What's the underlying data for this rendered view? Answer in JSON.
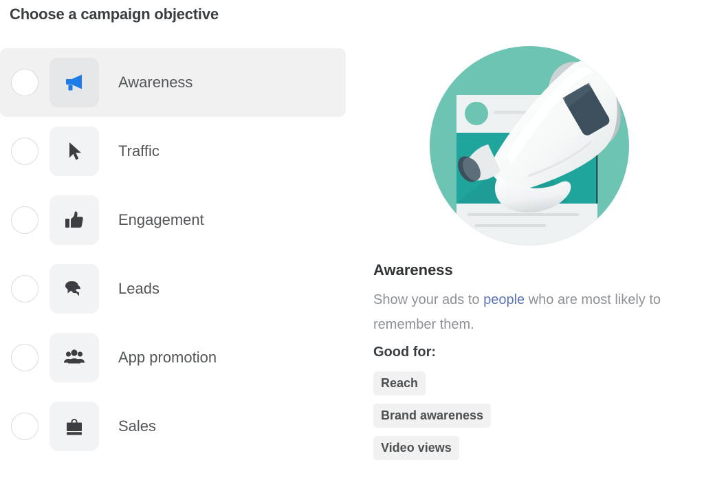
{
  "page": {
    "title": "Choose a campaign objective"
  },
  "objectives": [
    {
      "id": "awareness",
      "label": "Awareness",
      "icon": "megaphone-icon",
      "selected": true,
      "icon_color": "#1d7ce8"
    },
    {
      "id": "traffic",
      "label": "Traffic",
      "icon": "cursor-arrow-icon",
      "selected": false,
      "icon_color": "#3b3f42"
    },
    {
      "id": "engagement",
      "label": "Engagement",
      "icon": "thumbs-up-icon",
      "selected": false,
      "icon_color": "#3b3f42"
    },
    {
      "id": "leads",
      "label": "Leads",
      "icon": "chat-bubbles-icon",
      "selected": false,
      "icon_color": "#3b3f42"
    },
    {
      "id": "app-promotion",
      "label": "App promotion",
      "icon": "people-group-icon",
      "selected": false,
      "icon_color": "#3b3f42"
    },
    {
      "id": "sales",
      "label": "Sales",
      "icon": "shopping-bag-icon",
      "selected": false,
      "icon_color": "#3b3f42"
    }
  ],
  "detail": {
    "illustration": "megaphone-illustration",
    "title": "Awareness",
    "description_before": "Show your ads to ",
    "description_link": "people",
    "description_after": " who are most likely to remember them.",
    "good_for_label": "Good for:",
    "chips": [
      "Reach",
      "Brand awareness",
      "Video views"
    ]
  },
  "colors": {
    "accent_blue": "#1d7ce8",
    "link_blue": "#5b73b5",
    "selected_row_bg": "#f1f1f2",
    "icon_tile_bg": "#f2f3f4",
    "icon_tile_bg_selected": "#e4e6e8",
    "chip_bg": "#f1f1f2",
    "text_primary": "#3b3f42",
    "text_secondary": "#8d9195",
    "illustration_circle": "#6ec4b3",
    "illustration_teal_dark": "#1fa59b",
    "illustration_card": "#eef1f2",
    "illustration_cone_dark": "#3d4f5c"
  }
}
